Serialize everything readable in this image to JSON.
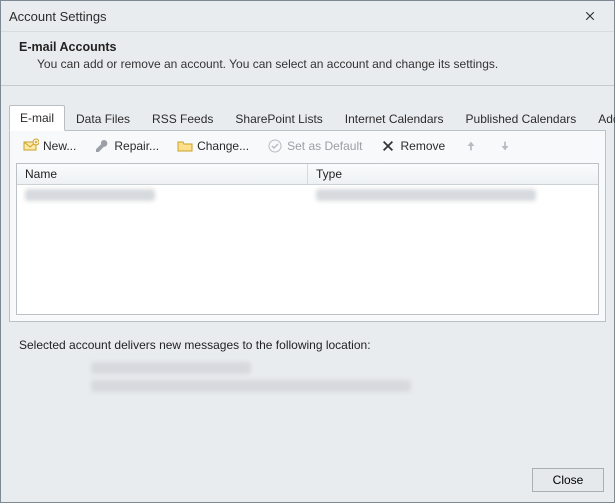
{
  "window": {
    "title": "Account Settings"
  },
  "header": {
    "heading": "E-mail Accounts",
    "subheading": "You can add or remove an account. You can select an account and change its settings."
  },
  "tabs": [
    {
      "label": "E-mail",
      "active": true
    },
    {
      "label": "Data Files",
      "active": false
    },
    {
      "label": "RSS Feeds",
      "active": false
    },
    {
      "label": "SharePoint Lists",
      "active": false
    },
    {
      "label": "Internet Calendars",
      "active": false
    },
    {
      "label": "Published Calendars",
      "active": false
    },
    {
      "label": "Address Books",
      "active": false
    }
  ],
  "toolbar": {
    "new": "New...",
    "repair": "Repair...",
    "change": "Change...",
    "set_default": "Set as Default",
    "remove": "Remove"
  },
  "list": {
    "columns": {
      "name": "Name",
      "type": "Type"
    }
  },
  "delivery_label": "Selected account delivers new messages to the following location:",
  "buttons": {
    "close": "Close"
  }
}
